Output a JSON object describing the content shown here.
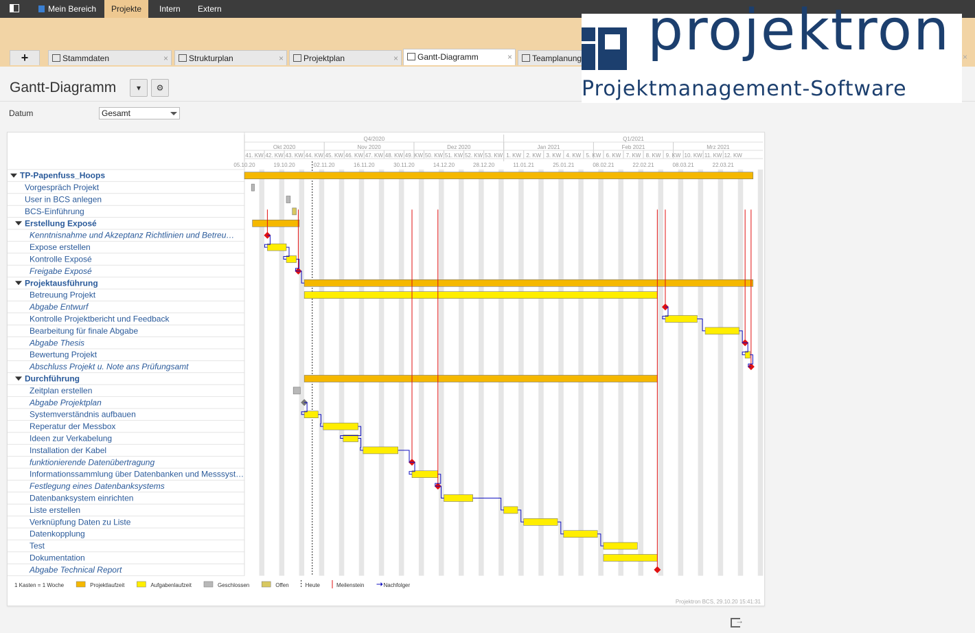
{
  "topnav": {
    "items": [
      {
        "label": "Mein Bereich",
        "active": false,
        "home": true
      },
      {
        "label": "Projekte",
        "active": true
      },
      {
        "label": "Intern",
        "active": false
      },
      {
        "label": "Extern",
        "active": false
      }
    ]
  },
  "tabs": [
    {
      "label": "+",
      "type": "plus"
    },
    {
      "label": "Stammdaten",
      "icon": "stammdaten-icon"
    },
    {
      "label": "Strukturplan",
      "icon": "strukturplan-icon"
    },
    {
      "label": "Projektplan",
      "icon": "projektplan-icon"
    },
    {
      "label": "Gantt-Diagramm",
      "icon": "gantt-icon",
      "active": true
    },
    {
      "label": "Teamplanung",
      "icon": "teamplanung-icon"
    }
  ],
  "logo": {
    "word": "projektron",
    "tagline": "Projektmanagement-Software"
  },
  "page": {
    "title": "Gantt-Diagramm",
    "menu_button": "▾",
    "settings_button": "⚙"
  },
  "filter": {
    "label": "Datum",
    "value": "Gesamt"
  },
  "gantt": {
    "header": {
      "quarters": [
        {
          "label": "Q4/2020",
          "start": 0,
          "end": 13
        },
        {
          "label": "Q1/2021",
          "start": 13,
          "end": 26
        }
      ],
      "months": [
        {
          "label": "Okt 2020",
          "start": 0,
          "end": 4
        },
        {
          "label": "Nov 2020",
          "start": 4,
          "end": 8.5
        },
        {
          "label": "Dez 2020",
          "start": 8.5,
          "end": 13
        },
        {
          "label": "Jan 2021",
          "start": 13,
          "end": 17.5
        },
        {
          "label": "Feb 2021",
          "start": 17.5,
          "end": 21.5
        },
        {
          "label": "Mrz 2021",
          "start": 21.5,
          "end": 26
        }
      ],
      "weeks": [
        "41. KW",
        "42. KW",
        "43. KW",
        "44. KW",
        "45. KW",
        "46. KW",
        "47. KW",
        "48. KW",
        "49. KW",
        "50. KW",
        "51. KW",
        "52. KW",
        "53. KW",
        "1. KW",
        "2. KW",
        "3. KW",
        "4. KW",
        "5. KW",
        "6. KW",
        "7. KW",
        "8. KW",
        "9. KW",
        "10. KW",
        "11. KW",
        "12. KW"
      ],
      "dates": [
        "05.10.20",
        "19.10.20",
        "02.11.20",
        "16.11.20",
        "30.11.20",
        "14.12.20",
        "28.12.20",
        "11.01.21",
        "25.01.21",
        "08.02.21",
        "22.02.21",
        "08.03.21",
        "22.03.21"
      ]
    },
    "today_week": 3.4,
    "tasks": [
      {
        "name": "TP-Papenfuss_Hoops",
        "level": 0,
        "group": true,
        "bar": {
          "start": 0,
          "end": 25.5,
          "type": "project"
        }
      },
      {
        "name": "Vorgespräch Projekt",
        "level": 1,
        "bar": {
          "start": 0.35,
          "end": 0.5,
          "type": "closed"
        }
      },
      {
        "name": "User in BCS anlegen",
        "level": 1,
        "bar": {
          "start": 2.1,
          "end": 2.3,
          "type": "closed"
        }
      },
      {
        "name": "BCS-Einführung",
        "level": 1,
        "bar": {
          "start": 2.4,
          "end": 2.6,
          "type": "open"
        }
      },
      {
        "name": "Erstellung Exposé",
        "level": 1,
        "group": true,
        "bar": {
          "start": 0.4,
          "end": 2.75,
          "type": "project"
        }
      },
      {
        "name": "Kenntnisnahme und Akzeptanz Richtlinien und Betreu…",
        "level": 2,
        "italic": true,
        "milestone": 1.15
      },
      {
        "name": "Expose erstellen",
        "level": 2,
        "bar": {
          "start": 1.15,
          "end": 2.1,
          "type": "task"
        }
      },
      {
        "name": "Kontrolle Exposé",
        "level": 2,
        "bar": {
          "start": 2.1,
          "end": 2.6,
          "type": "task"
        }
      },
      {
        "name": "Freigabe Exposé",
        "level": 2,
        "italic": true,
        "milestone": 2.7
      },
      {
        "name": "Projektausführung",
        "level": 1,
        "group": true,
        "bar": {
          "start": 3.0,
          "end": 25.5,
          "type": "project"
        }
      },
      {
        "name": "Betreuung Projekt",
        "level": 2,
        "bar": {
          "start": 3.0,
          "end": 20.7,
          "type": "task"
        }
      },
      {
        "name": "Abgabe Entwurf",
        "level": 2,
        "italic": true,
        "milestone": 21.1
      },
      {
        "name": "Kontrolle Projektbericht und Feedback",
        "level": 2,
        "bar": {
          "start": 21.1,
          "end": 22.7,
          "type": "task"
        }
      },
      {
        "name": "Bearbeitung für finale Abgabe",
        "level": 2,
        "bar": {
          "start": 23.1,
          "end": 24.8,
          "type": "task"
        }
      },
      {
        "name": "Abgabe Thesis",
        "level": 2,
        "italic": true,
        "milestone": 25.1
      },
      {
        "name": "Bewertung Projekt",
        "level": 2,
        "bar": {
          "start": 25.1,
          "end": 25.35,
          "type": "task"
        }
      },
      {
        "name": "Abschluss Projekt u. Note ans Prüfungsamt",
        "level": 2,
        "italic": true,
        "milestone": 25.4
      },
      {
        "name": "Durchführung",
        "level": 1,
        "group": true,
        "bar": {
          "start": 3.0,
          "end": 20.7,
          "type": "project"
        }
      },
      {
        "name": "Zeitplan erstellen",
        "level": 2,
        "bar": {
          "start": 2.45,
          "end": 2.8,
          "type": "closed"
        }
      },
      {
        "name": "Abgabe Projektplan",
        "level": 2,
        "italic": true,
        "milestone_grey": 3.0
      },
      {
        "name": "Systemverständnis aufbauen",
        "level": 2,
        "bar": {
          "start": 3.0,
          "end": 3.7,
          "type": "task"
        }
      },
      {
        "name": "Reperatur der Messbox",
        "level": 2,
        "bar": {
          "start": 3.95,
          "end": 5.7,
          "type": "task"
        }
      },
      {
        "name": "Ideen zur Verkabelung",
        "level": 2,
        "bar": {
          "start": 4.95,
          "end": 5.7,
          "type": "task"
        }
      },
      {
        "name": "Installation der Kabel",
        "level": 2,
        "bar": {
          "start": 5.95,
          "end": 7.7,
          "type": "task"
        }
      },
      {
        "name": "funktionierende Datenübertragung",
        "level": 2,
        "italic": true,
        "milestone": 8.4
      },
      {
        "name": "Informationssammlung über Datenbanken und Messsyst…",
        "level": 2,
        "bar": {
          "start": 8.4,
          "end": 9.7,
          "type": "task"
        }
      },
      {
        "name": "Festlegung eines Datenbanksystems",
        "level": 2,
        "italic": true,
        "milestone": 9.7
      },
      {
        "name": "Datenbanksystem einrichten",
        "level": 2,
        "bar": {
          "start": 10.0,
          "end": 11.45,
          "type": "task"
        }
      },
      {
        "name": "Liste erstellen",
        "level": 2,
        "bar": {
          "start": 13.0,
          "end": 13.7,
          "type": "task"
        }
      },
      {
        "name": "Verknüpfung Daten zu Liste",
        "level": 2,
        "bar": {
          "start": 14.0,
          "end": 15.7,
          "type": "task"
        }
      },
      {
        "name": "Datenkopplung",
        "level": 2,
        "bar": {
          "start": 16.0,
          "end": 17.7,
          "type": "task"
        }
      },
      {
        "name": "Test",
        "level": 2,
        "bar": {
          "start": 18.0,
          "end": 19.7,
          "type": "task"
        }
      },
      {
        "name": "Dokumentation",
        "level": 2,
        "bar": {
          "start": 18.0,
          "end": 20.7,
          "type": "task"
        }
      },
      {
        "name": "Abgabe Technical Report",
        "level": 2,
        "italic": true,
        "milestone": 20.7
      }
    ],
    "legend": [
      {
        "label": "1 Kasten = 1 Woche",
        "type": "none"
      },
      {
        "label": "Projektlaufzeit",
        "type": "project"
      },
      {
        "label": "Aufgabenlaufzeit",
        "type": "task"
      },
      {
        "label": "Geschlossen",
        "type": "closed"
      },
      {
        "label": "Offen",
        "type": "open"
      },
      {
        "label": "Heute",
        "type": "today"
      },
      {
        "label": "Meilenstein",
        "type": "milestone"
      },
      {
        "label": "Nachfolger",
        "type": "successor"
      }
    ],
    "footer": "Projektron BCS, 29.10.20  15:41:31",
    "colors": {
      "project": "#f5b800",
      "task": "#ffee00",
      "closed": "#b8b8b8",
      "open": "#d8c860",
      "milestone": "#e01010",
      "link": "#1010c0",
      "name": "#2a5a9a",
      "stripe": "#e6e6e6"
    }
  }
}
